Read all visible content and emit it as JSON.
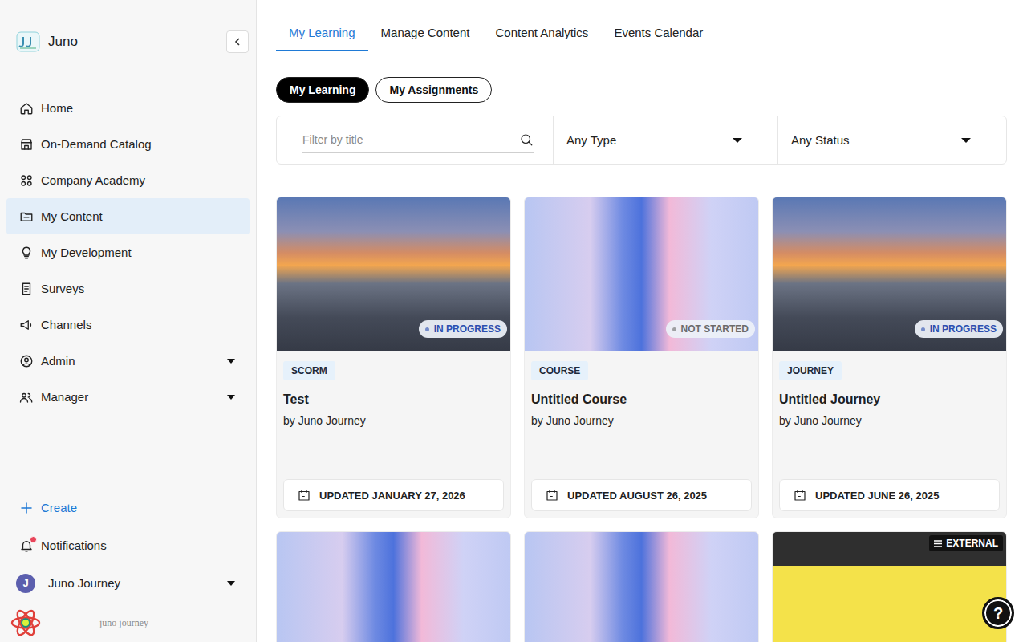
{
  "brand": {
    "name": "Juno"
  },
  "sidebar": {
    "items": [
      {
        "label": "Home",
        "selected": false,
        "expandable": false
      },
      {
        "label": "On-Demand Catalog",
        "selected": false,
        "expandable": false
      },
      {
        "label": "Company Academy",
        "selected": false,
        "expandable": false
      },
      {
        "label": "My Content",
        "selected": true,
        "expandable": false
      },
      {
        "label": "My Development",
        "selected": false,
        "expandable": false
      },
      {
        "label": "Surveys",
        "selected": false,
        "expandable": false
      },
      {
        "label": "Channels",
        "selected": false,
        "expandable": false
      },
      {
        "label": "Admin",
        "selected": false,
        "expandable": true
      },
      {
        "label": "Manager",
        "selected": false,
        "expandable": true
      }
    ],
    "create": "Create",
    "notifications": {
      "label": "Notifications",
      "unread": true
    },
    "user": {
      "initial": "J",
      "name": "Juno Journey"
    },
    "footer": "juno journey"
  },
  "tabs": [
    {
      "label": "My Learning",
      "selected": true
    },
    {
      "label": "Manage Content",
      "selected": false
    },
    {
      "label": "Content Analytics",
      "selected": false
    },
    {
      "label": "Events Calendar",
      "selected": false
    }
  ],
  "pills": [
    {
      "label": "My Learning",
      "selected": true
    },
    {
      "label": "My Assignments",
      "selected": false
    }
  ],
  "filters": {
    "search_placeholder": "Filter by title",
    "type": "Any Type",
    "status": "Any Status"
  },
  "cards": [
    {
      "cover": "city",
      "status": "IN PROGRESS",
      "status_color": "#2c4fb0",
      "type": "SCORM",
      "title": "Test",
      "author": "by Juno Journey",
      "updated": "UPDATED JANUARY 27, 2026"
    },
    {
      "cover": "abstract",
      "status": "NOT STARTED",
      "status_color": "#6b6b6b",
      "type": "COURSE",
      "title": "Untitled Course",
      "author": "by Juno Journey",
      "updated": "UPDATED AUGUST 26, 2025"
    },
    {
      "cover": "city",
      "status": "IN PROGRESS",
      "status_color": "#2c4fb0",
      "type": "JOURNEY",
      "title": "Untitled Journey",
      "author": "by Juno Journey",
      "updated": "UPDATED JUNE 26, 2025"
    },
    {
      "cover": "abstract"
    },
    {
      "cover": "abstract"
    },
    {
      "cover": "external",
      "badge": "EXTERNAL"
    }
  ],
  "help": "?"
}
